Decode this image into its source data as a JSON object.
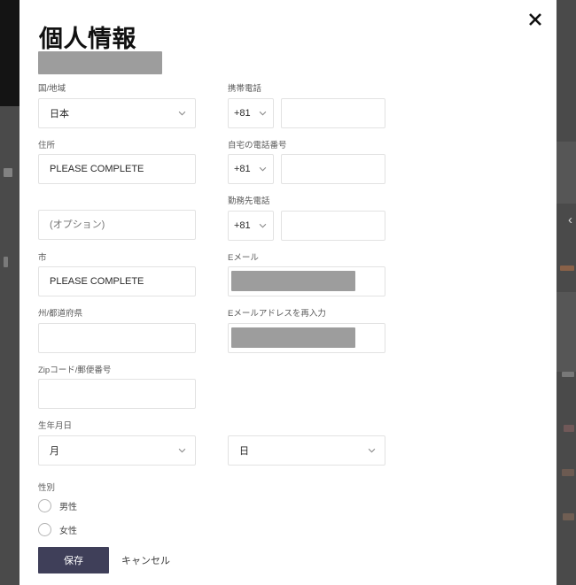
{
  "modal": {
    "title": "個人情報",
    "close_icon": "close-icon",
    "title_redacted": true
  },
  "fields": {
    "country": {
      "label": "国/地域",
      "value": "日本"
    },
    "mobile_phone": {
      "label": "携帯電話",
      "code": "+81",
      "number": ""
    },
    "address1": {
      "label": "住所",
      "value": "PLEASE COMPLETE"
    },
    "home_phone": {
      "label": "自宅の電話番号",
      "code": "+81",
      "number": ""
    },
    "address2": {
      "label": "",
      "placeholder": "(オプション)",
      "value": ""
    },
    "work_phone": {
      "label": "勤務先電話",
      "code": "+81",
      "number": ""
    },
    "city": {
      "label": "市",
      "value": "PLEASE COMPLETE"
    },
    "email": {
      "label": "Eメール",
      "value": "",
      "redacted": true
    },
    "state": {
      "label": "州/都道府県",
      "value": ""
    },
    "email_confirm": {
      "label": "Eメールアドレスを再入力",
      "value": "",
      "redacted": true
    },
    "zip": {
      "label": "Zipコード/郵便番号",
      "value": ""
    },
    "birthdate": {
      "label": "生年月日",
      "month": "月",
      "day": "日"
    },
    "gender": {
      "label": "性別",
      "options": [
        {
          "label": "男性",
          "selected": false
        },
        {
          "label": "女性",
          "selected": false
        }
      ]
    }
  },
  "footer": {
    "save_label": "保存",
    "cancel_label": "キャンセル"
  },
  "colors": {
    "save_button": "#3f3f59",
    "redaction": "#9d9d9d",
    "field_border": "#e2e2e2",
    "backdrop": "#4a4a4a"
  }
}
